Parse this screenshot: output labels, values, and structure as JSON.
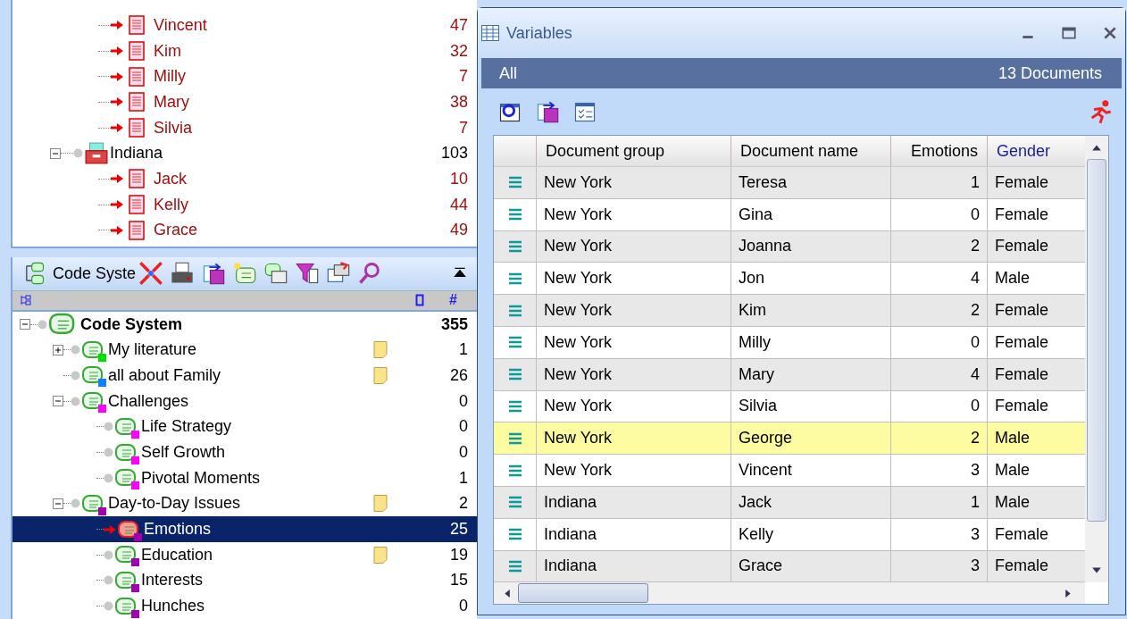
{
  "document_tree": [
    {
      "kind": "document",
      "name": "Vincent",
      "count": "47",
      "activated": true
    },
    {
      "kind": "document",
      "name": "Kim",
      "count": "32",
      "activated": true
    },
    {
      "kind": "document",
      "name": "Milly",
      "count": "7",
      "activated": true
    },
    {
      "kind": "document",
      "name": "Mary",
      "count": "38",
      "activated": true
    },
    {
      "kind": "document",
      "name": "Silvia",
      "count": "7",
      "activated": true
    },
    {
      "kind": "group",
      "name": "Indiana",
      "count": "103",
      "expanded": true,
      "activated": false,
      "children": [
        {
          "kind": "document",
          "name": "Jack",
          "count": "10",
          "activated": true
        },
        {
          "kind": "document",
          "name": "Kelly",
          "count": "44",
          "activated": true
        },
        {
          "kind": "document",
          "name": "Grace",
          "count": "49",
          "activated": true
        }
      ]
    }
  ],
  "code_panel": {
    "title": "Code Syste",
    "count_header": "#",
    "tree": [
      {
        "name": "Code System",
        "count": "355",
        "expanded": true,
        "root": true,
        "memo": false,
        "selected": false,
        "activated": false,
        "children": [
          {
            "name": "My literature",
            "count": "1",
            "color": "#00e000",
            "expanded": false,
            "memo": true,
            "selected": false,
            "activated": false
          },
          {
            "name": "all about Family",
            "count": "26",
            "color": "#1080ff",
            "memo": true,
            "selected": false,
            "activated": false
          },
          {
            "name": "Challenges",
            "count": "0",
            "color": "#ff00ff",
            "expanded": true,
            "memo": false,
            "selected": false,
            "activated": false,
            "children": [
              {
                "name": "Life Strategy",
                "count": "0",
                "color": "#ff00ff",
                "memo": false,
                "selected": false,
                "activated": false
              },
              {
                "name": "Self Growth",
                "count": "0",
                "color": "#ff00ff",
                "memo": false,
                "selected": false,
                "activated": false
              },
              {
                "name": "Pivotal Moments",
                "count": "1",
                "color": "#ff00ff",
                "memo": false,
                "selected": false,
                "activated": false
              }
            ]
          },
          {
            "name": "Day-to-Day Issues",
            "count": "2",
            "color": "#a000b0",
            "expanded": true,
            "memo": true,
            "selected": false,
            "activated": false,
            "children": [
              {
                "name": "Emotions",
                "count": "25",
                "color": "#a000b0",
                "memo": false,
                "selected": true,
                "activated": true
              },
              {
                "name": "Education",
                "count": "19",
                "color": "#a000b0",
                "memo": true,
                "selected": false,
                "activated": false
              },
              {
                "name": "Interests",
                "count": "15",
                "color": "#a000b0",
                "memo": false,
                "selected": false,
                "activated": false
              },
              {
                "name": "Hunches",
                "count": "0",
                "color": "#a000b0",
                "memo": false,
                "selected": false,
                "activated": false
              }
            ]
          }
        ]
      }
    ]
  },
  "variables_window": {
    "title": "Variables",
    "filter": "All",
    "document_count": "13 Documents",
    "columns": [
      {
        "label": "Document group",
        "kind": "system"
      },
      {
        "label": "Document name",
        "kind": "system"
      },
      {
        "label": "Emotions",
        "kind": "code"
      },
      {
        "label": "Gender",
        "kind": "user"
      }
    ],
    "rows": [
      {
        "group": "New York",
        "name": "Teresa",
        "emotions": "1",
        "gender": "Female",
        "selected": false
      },
      {
        "group": "New York",
        "name": "Gina",
        "emotions": "0",
        "gender": "Female",
        "selected": false
      },
      {
        "group": "New York",
        "name": "Joanna",
        "emotions": "2",
        "gender": "Female",
        "selected": false
      },
      {
        "group": "New York",
        "name": "Jon",
        "emotions": "4",
        "gender": "Male",
        "selected": false
      },
      {
        "group": "New York",
        "name": "Kim",
        "emotions": "2",
        "gender": "Female",
        "selected": false
      },
      {
        "group": "New York",
        "name": "Milly",
        "emotions": "0",
        "gender": "Female",
        "selected": false
      },
      {
        "group": "New York",
        "name": "Mary",
        "emotions": "4",
        "gender": "Female",
        "selected": false
      },
      {
        "group": "New York",
        "name": "Silvia",
        "emotions": "0",
        "gender": "Female",
        "selected": false
      },
      {
        "group": "New York",
        "name": "George",
        "emotions": "2",
        "gender": "Male",
        "selected": true
      },
      {
        "group": "New York",
        "name": "Vincent",
        "emotions": "3",
        "gender": "Male",
        "selected": false
      },
      {
        "group": "Indiana",
        "name": "Jack",
        "emotions": "1",
        "gender": "Male",
        "selected": false
      },
      {
        "group": "Indiana",
        "name": "Kelly",
        "emotions": "3",
        "gender": "Female",
        "selected": false
      },
      {
        "group": "Indiana",
        "name": "Grace",
        "emotions": "3",
        "gender": "Female",
        "selected": false
      }
    ]
  }
}
